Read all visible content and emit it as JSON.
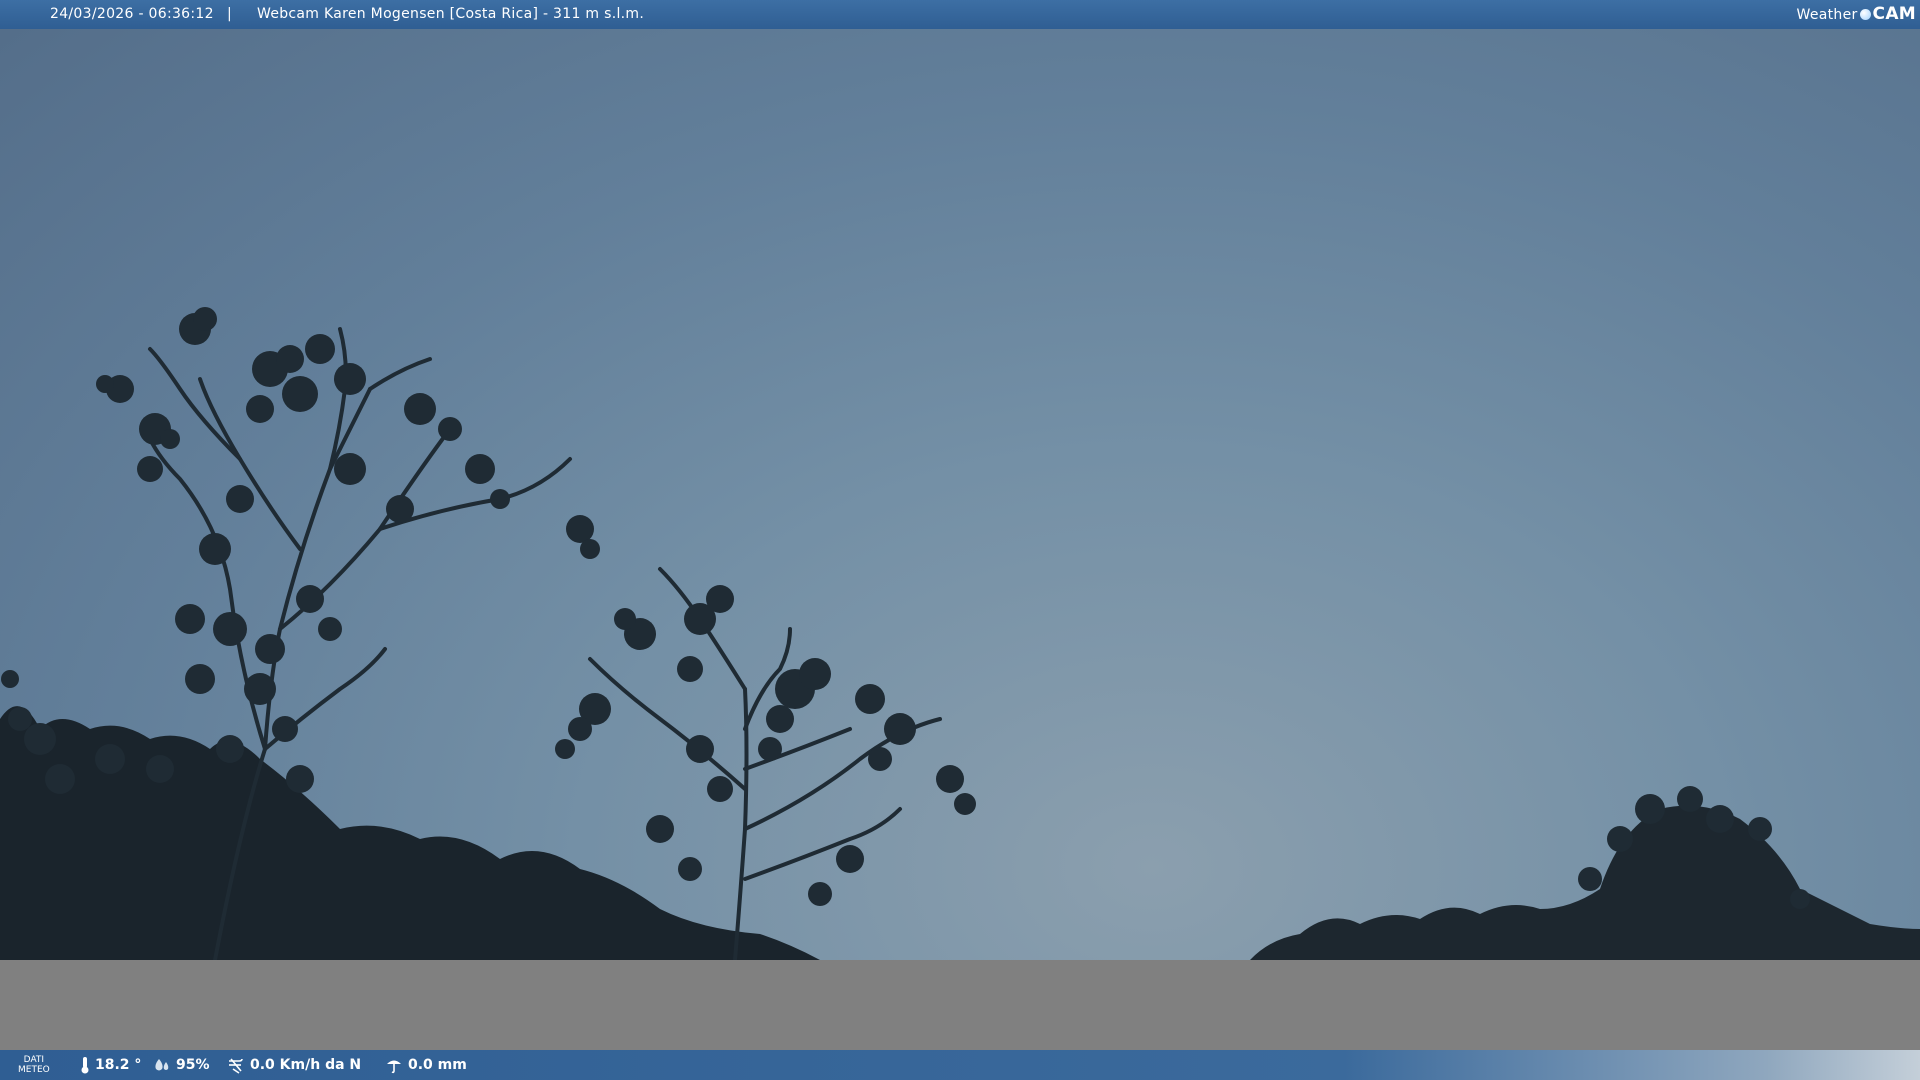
{
  "header": {
    "timestamp": "24/03/2026 - 06:36:12",
    "separator": "|",
    "title": "Webcam Karen Mogensen [Costa Rica]  - 311 m s.l.m.",
    "logo": {
      "word1": "Weather",
      "word2": "CAM"
    }
  },
  "weather": {
    "label_line1": "DATI",
    "label_line2": "METEO",
    "temperature": "18.2 °",
    "humidity": "95%",
    "wind": "0.0 Km/h da N",
    "rain": "0.0 mm"
  },
  "icons": {
    "temperature": "thermometer-icon",
    "humidity": "humidity-icon",
    "wind": "wind-icon",
    "rain": "rain-icon"
  },
  "colors": {
    "bar": "#2f5e93",
    "sky_top": "#546e8a",
    "sky_bottom": "#8b9fae",
    "foliage": "#1e2a33",
    "grey_band": "#808080"
  }
}
